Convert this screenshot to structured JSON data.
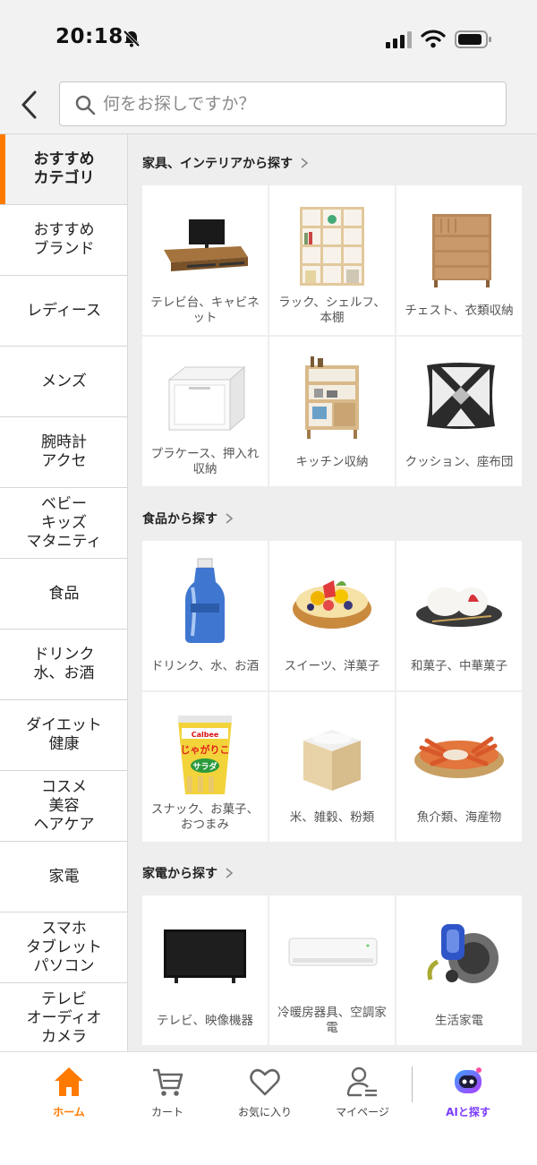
{
  "status": {
    "time": "20:18"
  },
  "search": {
    "placeholder": "何をお探しですか？"
  },
  "sidebar": {
    "items": [
      {
        "label": "おすすめ\nカテゴリ",
        "active": true
      },
      {
        "label": "おすすめ\nブランド"
      },
      {
        "label": "レディース"
      },
      {
        "label": "メンズ"
      },
      {
        "label": "腕時計\nアクセ"
      },
      {
        "label": "ベビー\nキッズ\nマタニティ"
      },
      {
        "label": "食品"
      },
      {
        "label": "ドリンク\n水、お酒"
      },
      {
        "label": "ダイエット\n健康"
      },
      {
        "label": "コスメ\n美容\nヘアケア"
      },
      {
        "label": "家電"
      },
      {
        "label": "スマホ\nタブレット\nパソコン"
      },
      {
        "label": "テレビ\nオーディオ\nカメラ"
      }
    ]
  },
  "sections": [
    {
      "title": "家具、インテリアから探す",
      "tiles": [
        {
          "label": "テレビ台、キャビネット",
          "icon": "tv-stand"
        },
        {
          "label": "ラック、シェルフ、本棚",
          "icon": "shelf"
        },
        {
          "label": "チェスト、衣類収納",
          "icon": "chest"
        },
        {
          "label": "プラケース、押入れ収納",
          "icon": "plastic-case"
        },
        {
          "label": "キッチン収納",
          "icon": "kitchen-rack"
        },
        {
          "label": "クッション、座布団",
          "icon": "cushion"
        }
      ]
    },
    {
      "title": "食品から探す",
      "tiles": [
        {
          "label": "ドリンク、水、お酒",
          "icon": "water-bottle"
        },
        {
          "label": "スイーツ、洋菓子",
          "icon": "fruit-tart"
        },
        {
          "label": "和菓子、中華菓子",
          "icon": "daifuku"
        },
        {
          "label": "スナック、お菓子、おつまみ",
          "icon": "snack-cup",
          "brand": "Calbee",
          "product": "じゃがりこ",
          "flavor": "サラダ"
        },
        {
          "label": "米、雑穀、粉類",
          "icon": "rice-box"
        },
        {
          "label": "魚介類、海産物",
          "icon": "crab"
        }
      ]
    },
    {
      "title": "家電から探す",
      "tiles": [
        {
          "label": "テレビ、映像機器",
          "icon": "tv"
        },
        {
          "label": "冷暖房器具、空調家電",
          "icon": "air-conditioner"
        },
        {
          "label": "生活家電",
          "icon": "vacuum"
        }
      ]
    }
  ],
  "nav": {
    "items": [
      {
        "label": "ホーム",
        "icon": "home-icon",
        "active": true
      },
      {
        "label": "カート",
        "icon": "cart-icon"
      },
      {
        "label": "お気に入り",
        "icon": "heart-icon"
      },
      {
        "label": "マイページ",
        "icon": "user-icon"
      },
      {
        "label": "AIと探す",
        "icon": "ai-robot-icon"
      }
    ]
  },
  "colors": {
    "accent": "#ff7a00",
    "ai": "#7b3cff"
  }
}
